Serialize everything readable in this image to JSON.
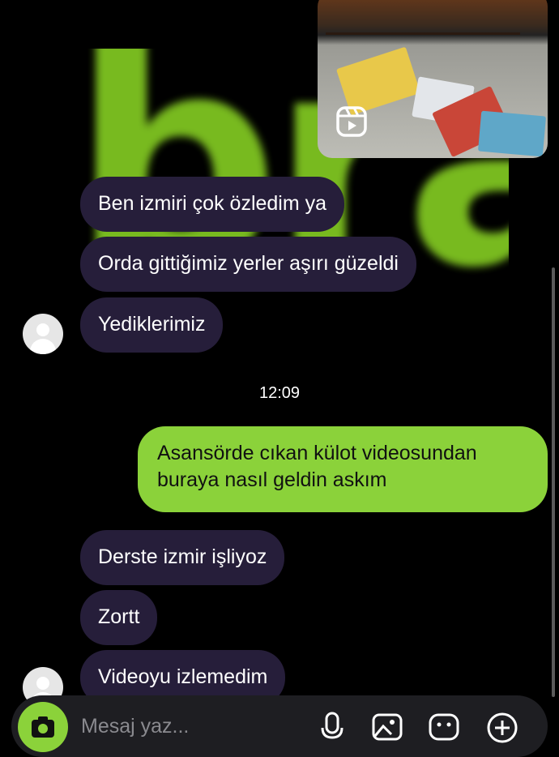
{
  "wallpaper": {
    "text": "brat",
    "color": "#7fc421"
  },
  "colors": {
    "accent": "#8bd23a",
    "incoming_bubble": "#261e3a",
    "background": "#000000"
  },
  "shared_media": {
    "type": "reel",
    "icon": "reels-icon"
  },
  "messages_before": [
    {
      "text": "Ben izmiri çok özledim ya"
    },
    {
      "text": "Orda gittiğimiz yerler aşırı güzeldi"
    },
    {
      "text": "Yediklerimiz"
    }
  ],
  "timestamp": "12:09",
  "sent_message": {
    "text": "Asansörde cıkan külot videosundan buraya nasıl geldin askım"
  },
  "messages_after": [
    {
      "text": "Derste izmir işliyoz"
    },
    {
      "text": "Zortt"
    },
    {
      "text": "Videoyu izlemedim"
    }
  ],
  "composer": {
    "placeholder": "Mesaj yaz...",
    "icons": [
      "camera-icon",
      "microphone-icon",
      "gallery-icon",
      "sticker-icon",
      "plus-icon"
    ]
  }
}
